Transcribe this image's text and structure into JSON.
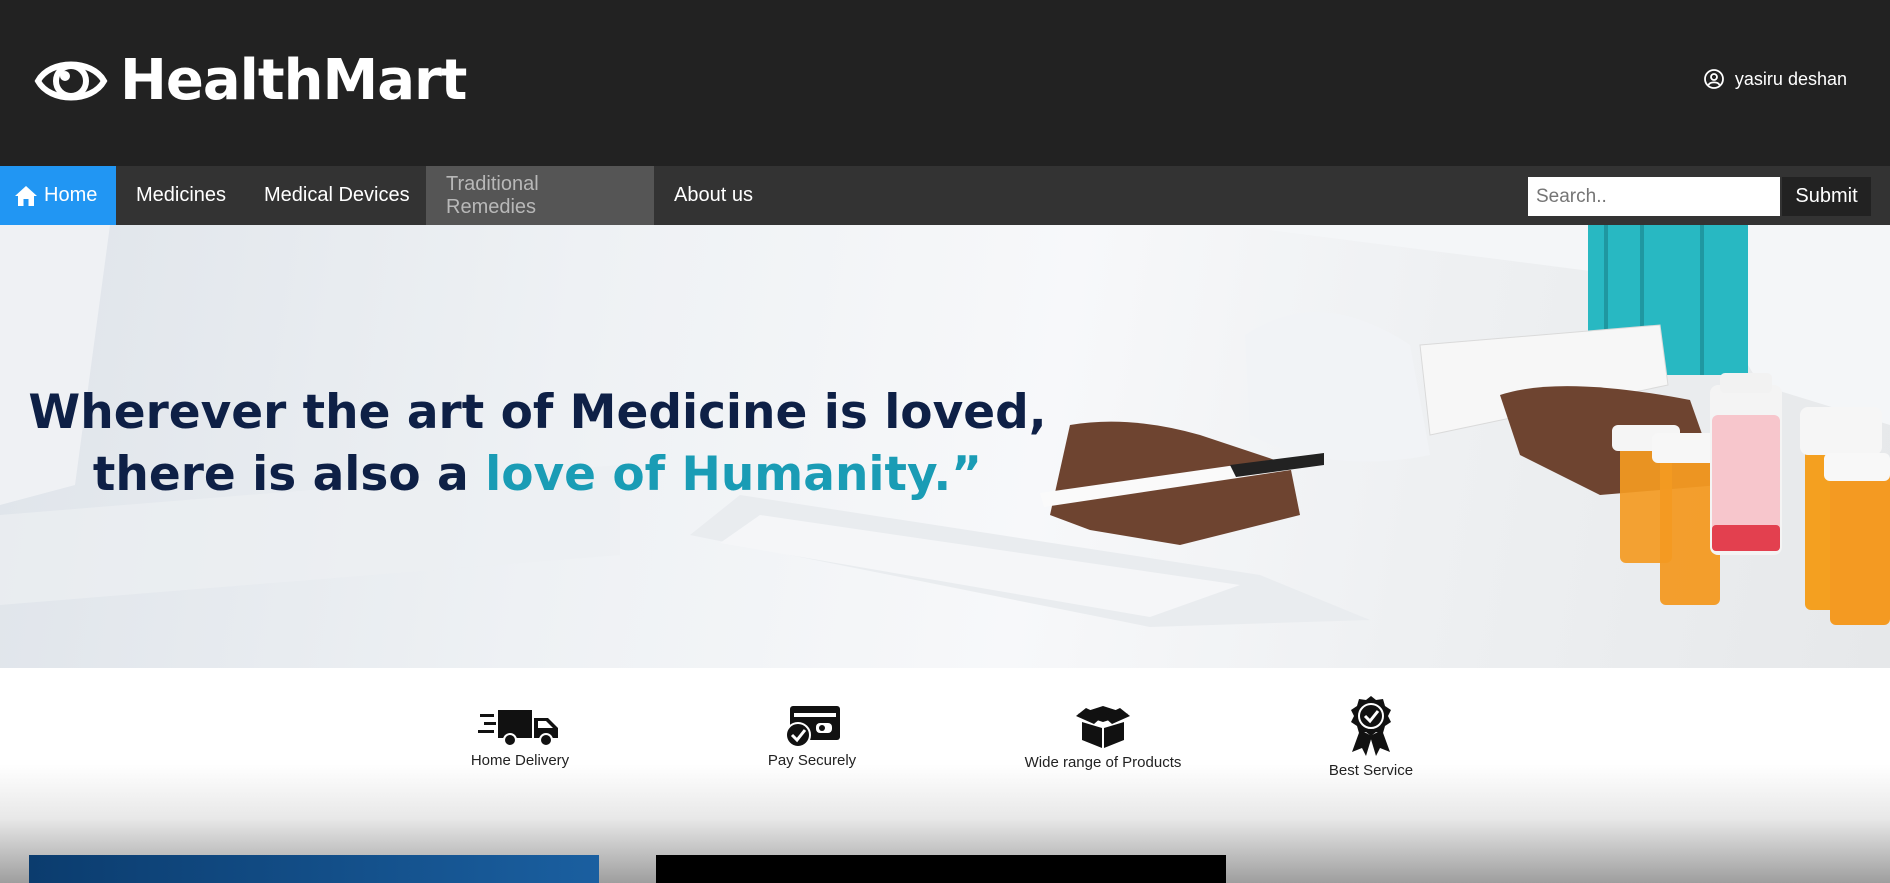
{
  "header": {
    "logo_icon": "eye-icon",
    "brand": "HealthMart",
    "user_icon": "user-circle-icon",
    "user_name": "yasiru deshan"
  },
  "nav": {
    "home_icon": "home-icon",
    "home_label": "Home",
    "items": [
      "Medicines",
      "Medical Devices",
      "Traditional Remedies",
      "About us"
    ],
    "active_color": "#2196f3"
  },
  "search": {
    "placeholder": "Search..",
    "value": "",
    "submit_label": "Submit"
  },
  "hero": {
    "line1": "Wherever the art of Medicine is loved,",
    "line2_prefix": "there is also a ",
    "line2_accent": "love of Humanity.”",
    "accent_color": "#1a9cb5",
    "text_color": "#0e2046"
  },
  "features": [
    {
      "icon": "truck-icon",
      "label": "Home Delivery"
    },
    {
      "icon": "card-check-icon",
      "label": "Pay Securely"
    },
    {
      "icon": "box-icon",
      "label": "Wide range of Products"
    },
    {
      "icon": "award-badge-icon",
      "label": "Best Service"
    }
  ]
}
